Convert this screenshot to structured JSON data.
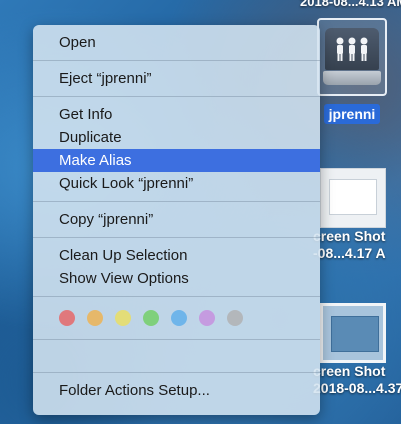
{
  "menu": {
    "items": [
      {
        "label": "Open"
      },
      {
        "label": "Eject “jprenni”"
      },
      {
        "label": "Get Info"
      },
      {
        "label": "Duplicate"
      },
      {
        "label": "Make Alias"
      },
      {
        "label": "Quick Look “jprenni”"
      },
      {
        "label": "Copy “jprenni”"
      },
      {
        "label": "Clean Up Selection"
      },
      {
        "label": "Show View Options"
      },
      {
        "label": "Folder Actions Setup..."
      }
    ],
    "highlighted_index": 4,
    "tag_colors": [
      "#e0787c",
      "#e6b86a",
      "#e3dd78",
      "#7fd07c",
      "#6fb5ea",
      "#c59be0",
      "#b3b7bb"
    ]
  },
  "desktop": {
    "top_partial_text": "2018-08...4.13 AM",
    "drive": {
      "label": "jprenni",
      "icon": "network-drive-icon"
    },
    "screenshot1": {
      "line1": "creen Shot",
      "line2": "-08...4.17 A"
    },
    "screenshot2": {
      "line1": "creen Shot",
      "line2": "2018-08...4.37"
    }
  },
  "colors": {
    "highlight": "#3d6fe0",
    "selected_label": "#2a6ad8"
  }
}
